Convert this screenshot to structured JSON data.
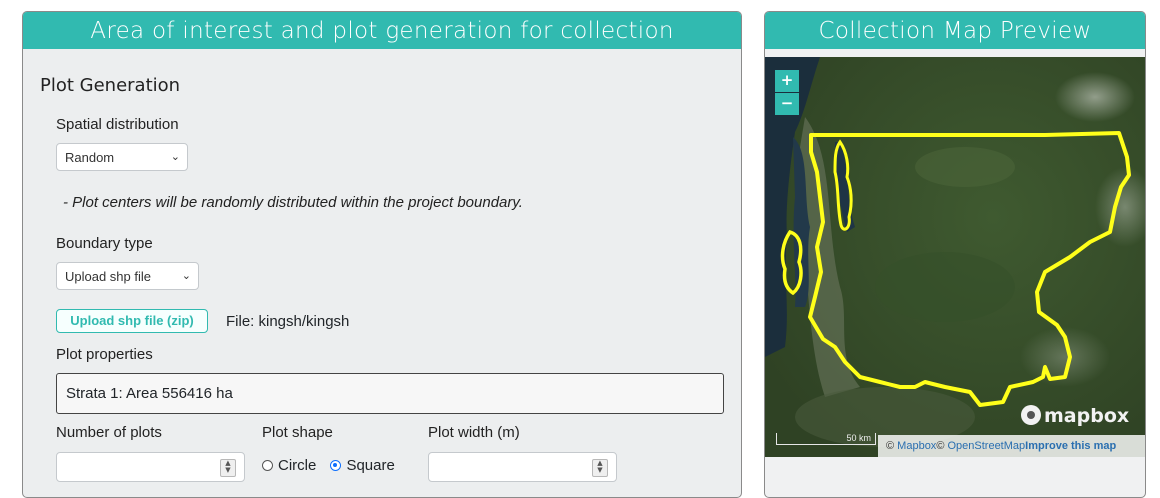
{
  "left_panel": {
    "header": "Area of interest and plot generation for collection",
    "section_title": "Plot Generation",
    "spatial_distribution": {
      "label": "Spatial distribution",
      "selected": "Random",
      "helper": "- Plot centers will be randomly distributed within the project boundary."
    },
    "boundary_type": {
      "label": "Boundary type",
      "selected": "Upload shp file"
    },
    "upload_button": "Upload shp file (zip)",
    "file_label": "File: kingsh/kingsh",
    "plot_properties": {
      "label": "Plot properties",
      "strata_text": "Strata 1: Area 556416 ha"
    },
    "number_of_plots": {
      "label": "Number of plots",
      "value": ""
    },
    "plot_shape": {
      "label": "Plot shape",
      "options": [
        "Circle",
        "Square"
      ],
      "selected": "Square"
    },
    "plot_width": {
      "label": "Plot width (m)",
      "value": ""
    }
  },
  "right_panel": {
    "header": "Collection Map Preview",
    "map": {
      "zoom_in": "+",
      "zoom_out": "−",
      "logo": "mapbox",
      "scale_label": "50 km",
      "attribution": {
        "copy1": "©",
        "mapbox": "Mapbox",
        "copy2": "©",
        "osm": "OpenStreetMap",
        "improve": "Improve this map"
      },
      "boundary_color": "#ffff1a"
    }
  },
  "colors": {
    "accent": "#31bab0",
    "radio_checked": "#0d6efd"
  }
}
